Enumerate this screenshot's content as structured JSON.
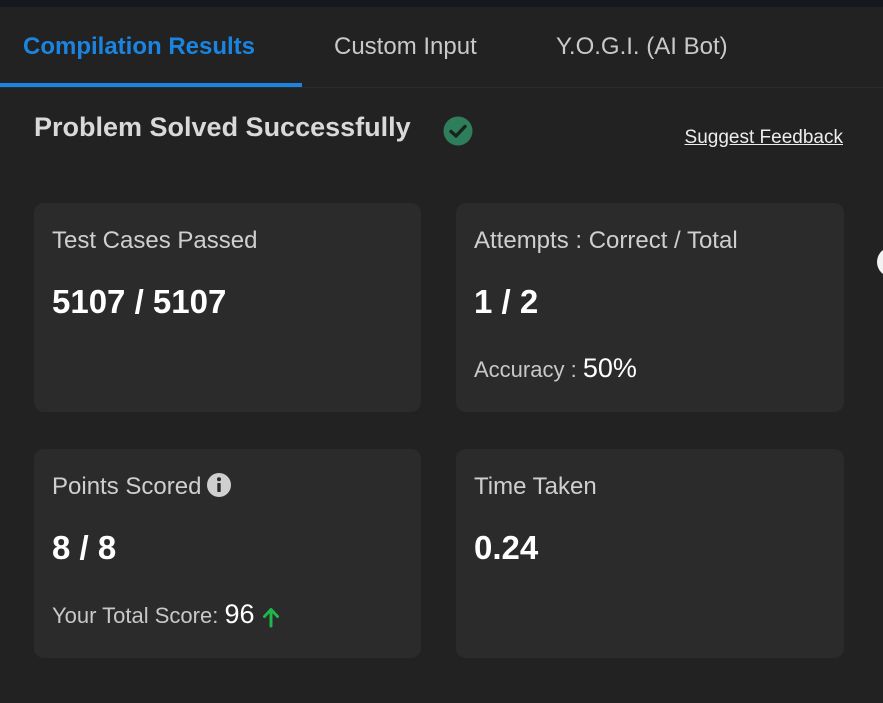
{
  "tabs": [
    {
      "label": "Compilation Results",
      "active": true
    },
    {
      "label": "Custom Input",
      "active": false
    },
    {
      "label": "Y.O.G.I. (AI Bot)",
      "active": false
    }
  ],
  "status": {
    "title": "Problem Solved Successfully",
    "icon": "check-circle-icon",
    "color": "#2e7d5b"
  },
  "feedback_link": "Suggest Feedback",
  "cards": {
    "test_cases": {
      "label": "Test Cases Passed",
      "value": "5107 / 5107"
    },
    "attempts": {
      "label": "Attempts : Correct / Total",
      "value": "1 / 2",
      "sub_label": "Accuracy : ",
      "sub_value": "50%"
    },
    "points": {
      "label": "Points Scored",
      "value": "8 / 8",
      "sub_label": "Your Total Score: ",
      "sub_value": "96",
      "trend_icon": "arrow-up-icon",
      "trend_color": "#1fb64a"
    },
    "time": {
      "label": "Time Taken",
      "value": "0.24"
    }
  },
  "colors": {
    "accent": "#1a84e0",
    "background": "#222222",
    "card": "#2b2b2b"
  }
}
